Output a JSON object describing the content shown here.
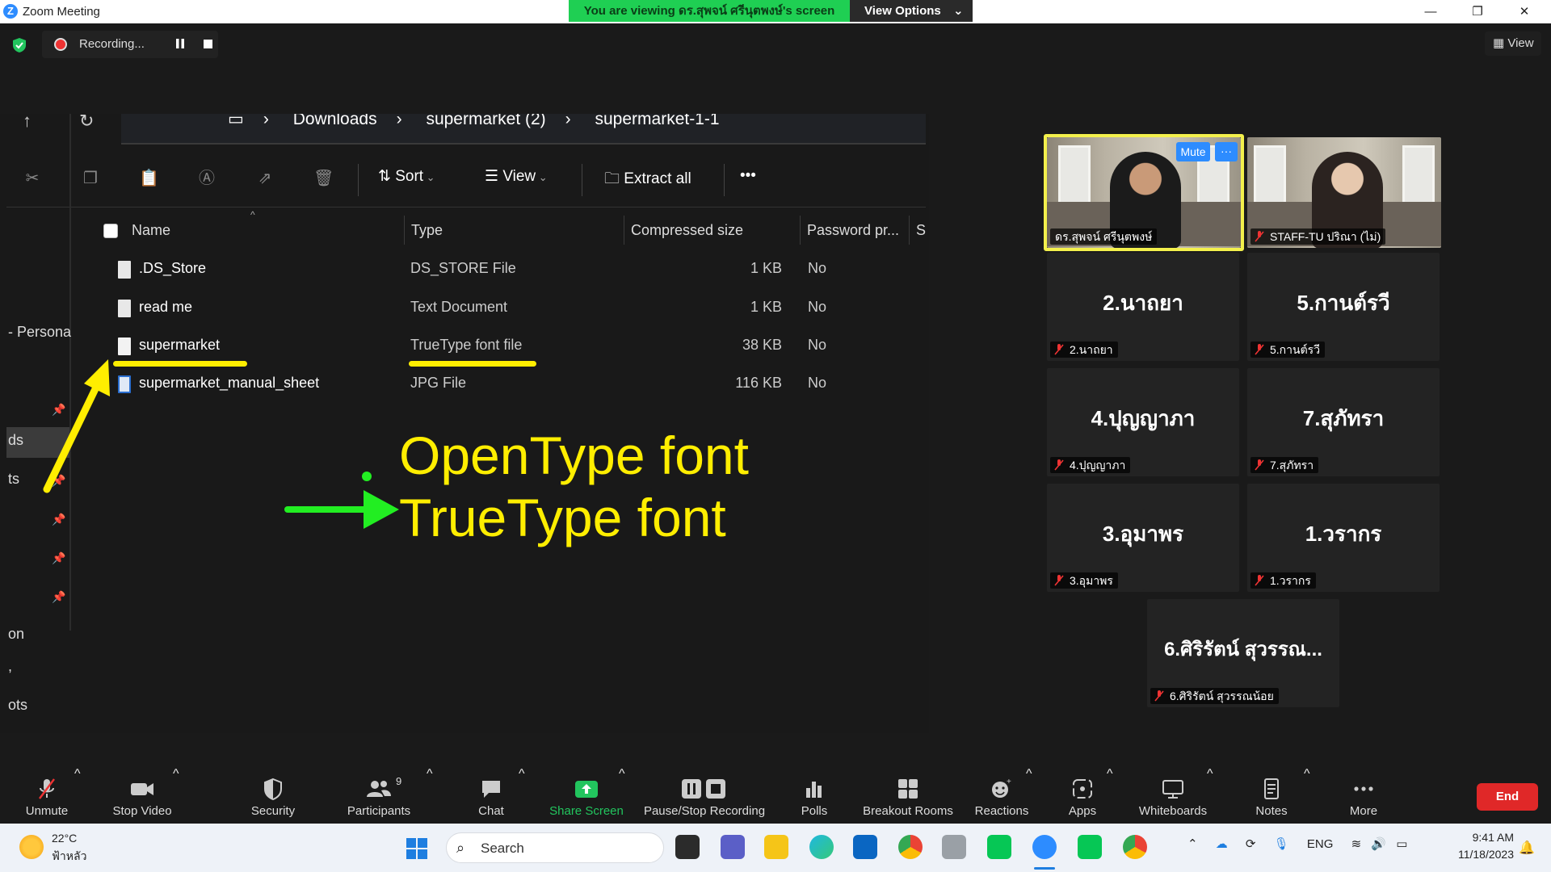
{
  "window": {
    "title": "Zoom Meeting",
    "minimize": "—",
    "restore": "❐",
    "close": "✕"
  },
  "banner": {
    "viewing_text": "You are viewing ดร.สุพจน์ ศรีนุตพงษ์'s screen",
    "view_options_label": "View Options"
  },
  "recording": {
    "label": "Recording..."
  },
  "view_button": {
    "label": "View"
  },
  "explorer": {
    "breadcrumbs": [
      "Downloads",
      "supermarket (2)",
      "supermarket-1-1"
    ],
    "toolbar": {
      "sort_label": "Sort",
      "view_label": "View",
      "extract_label": "Extract all",
      "more_label": "•••"
    },
    "left_pane": [
      "- Persona",
      "ds",
      "ts",
      "on",
      ",",
      "ots"
    ],
    "columns": [
      "Name",
      "Type",
      "Compressed size",
      "Password pr...",
      "S"
    ],
    "files": [
      {
        "name": ".DS_Store",
        "type": "DS_STORE File",
        "size": "1 KB",
        "password": "No"
      },
      {
        "name": "read me",
        "type": "Text Document",
        "size": "1 KB",
        "password": "No"
      },
      {
        "name": "supermarket",
        "type": "TrueType font file",
        "size": "38 KB",
        "password": "No"
      },
      {
        "name": "supermarket_manual_sheet",
        "type": "JPG File",
        "size": "116 KB",
        "password": "No"
      }
    ]
  },
  "annotations": {
    "line1": "OpenType font",
    "line2": "TrueType font",
    "highlight_color": "#ffee00",
    "arrow_color": "#22ee22"
  },
  "gallery": {
    "active_speaker": "ดร.สุพจน์ ศรีนุตพงษ์",
    "mute_label": "Mute",
    "more_label": "···",
    "second_video": "STAFF-TU ปริณา (ไม่)",
    "tiles": [
      {
        "big": "2.นาถยา",
        "label": "2.นาถยา"
      },
      {
        "big": "5.กานต์รวี",
        "label": "5.กานต์รวี"
      },
      {
        "big": "4.ปุญญาภา",
        "label": "4.ปุญญาภา"
      },
      {
        "big": "7.สุภัทรา",
        "label": "7.สุภัทรา"
      },
      {
        "big": "3.อุมาพร",
        "label": "3.อุมาพร"
      },
      {
        "big": "1.วรากร",
        "label": "1.วรากร"
      },
      {
        "big": "6.ศิริรัตน์ สุวรรณ...",
        "label": "6.ศิริรัตน์ สุวรรณน้อย"
      }
    ]
  },
  "zoom_toolbar": {
    "unmute": "Unmute",
    "stop_video": "Stop Video",
    "security": "Security",
    "participants": "Participants",
    "participant_count": "9",
    "chat": "Chat",
    "share_screen": "Share Screen",
    "pause_stop_recording": "Pause/Stop Recording",
    "polls": "Polls",
    "breakout_rooms": "Breakout Rooms",
    "reactions": "Reactions",
    "apps": "Apps",
    "whiteboards": "Whiteboards",
    "notes": "Notes",
    "more": "More",
    "end": "End",
    "share_color": "#22c55e",
    "end_color": "#e02828"
  },
  "taskbar": {
    "temperature": "22°C",
    "condition": "ฟ้าหลัว",
    "search_placeholder": "Search",
    "language": "ENG",
    "time": "9:41 AM",
    "date": "11/18/2023"
  }
}
